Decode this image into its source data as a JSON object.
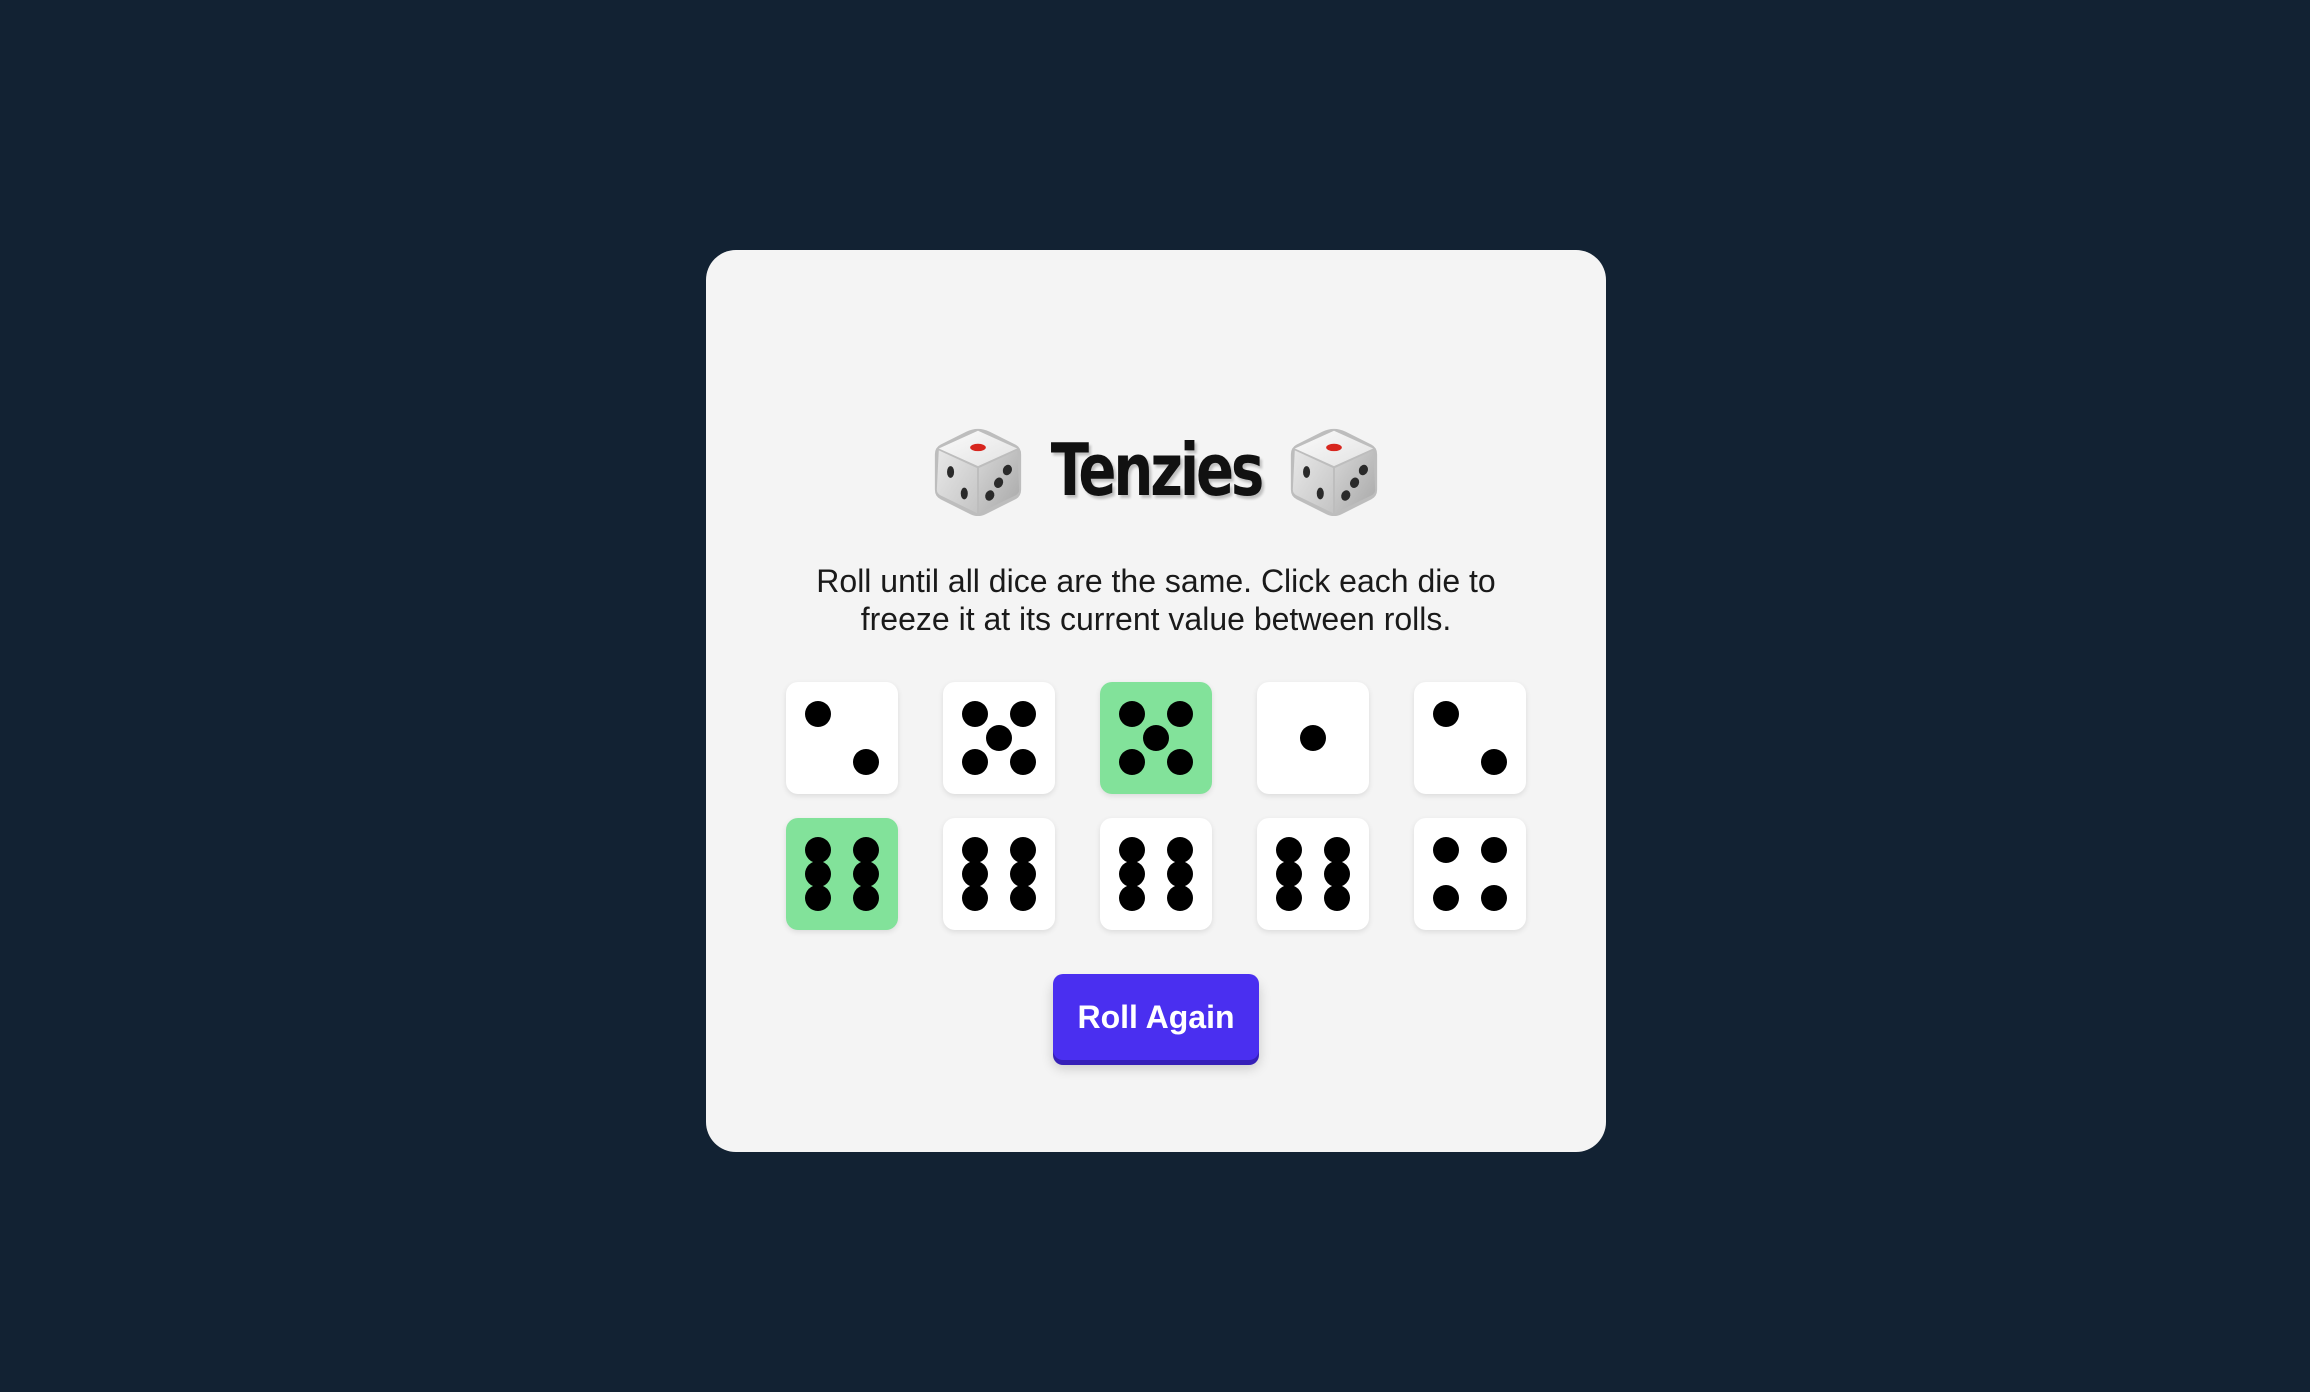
{
  "game": {
    "title": "Tenzies",
    "title_icon": "game-die-icon",
    "instructions": "Roll until all dice are the same. Click each die to freeze it at its current value between rolls.",
    "roll_button_label": "Roll Again",
    "colors": {
      "background": "#122233",
      "card": "#f4f4f4",
      "die": "#ffffff",
      "die_held": "#82e29a",
      "pip": "#000000",
      "button": "#4a2ff0",
      "button_text": "#ffffff"
    },
    "dice": [
      {
        "value": 2,
        "held": false
      },
      {
        "value": 5,
        "held": false
      },
      {
        "value": 5,
        "held": true
      },
      {
        "value": 1,
        "held": false
      },
      {
        "value": 2,
        "held": false
      },
      {
        "value": 6,
        "held": true
      },
      {
        "value": 6,
        "held": false
      },
      {
        "value": 6,
        "held": false
      },
      {
        "value": 6,
        "held": false
      },
      {
        "value": 4,
        "held": false
      }
    ]
  }
}
